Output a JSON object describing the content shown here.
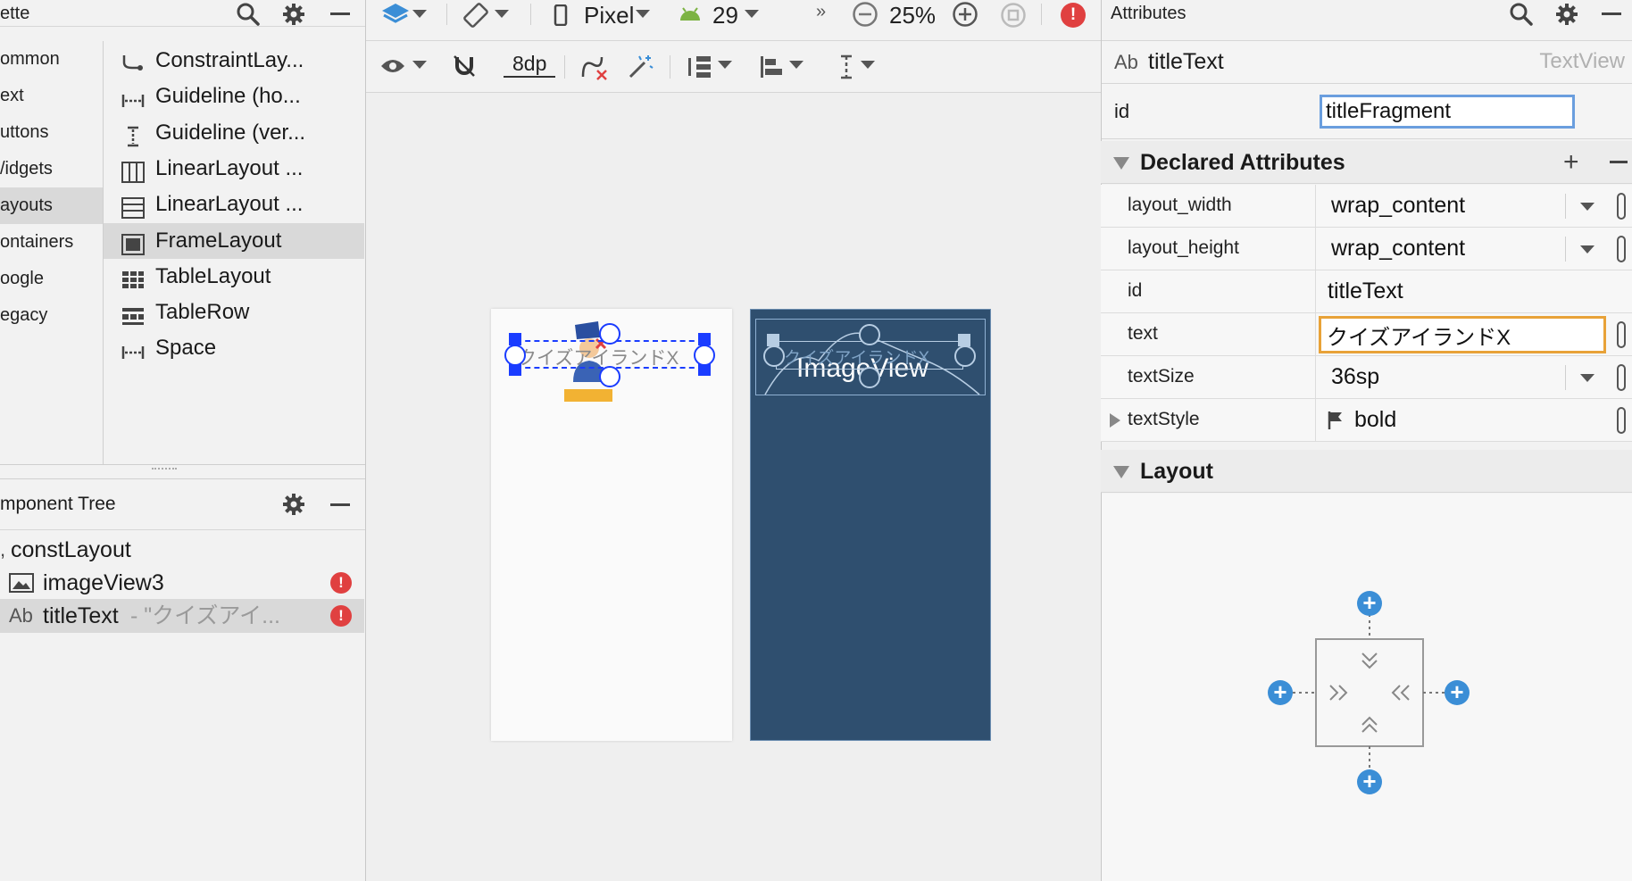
{
  "palette": {
    "title": "ette",
    "categories": [
      "ommon",
      "ext",
      "uttons",
      "/idgets",
      "ayouts",
      "ontainers",
      "oogle",
      "egacy"
    ],
    "selected_category": 4,
    "items": [
      {
        "label": "ConstraintLay...",
        "icon": "constraint-layout-icon"
      },
      {
        "label": "Guideline (ho...",
        "icon": "guideline-horizontal-icon"
      },
      {
        "label": "Guideline (ver...",
        "icon": "guideline-vertical-icon"
      },
      {
        "label": "LinearLayout ...",
        "icon": "linear-layout-vertical-icon"
      },
      {
        "label": "LinearLayout ...",
        "icon": "linear-layout-horizontal-icon"
      },
      {
        "label": "FrameLayout",
        "icon": "frame-layout-icon"
      },
      {
        "label": "TableLayout",
        "icon": "table-layout-icon"
      },
      {
        "label": "TableRow",
        "icon": "table-row-icon"
      },
      {
        "label": "Space",
        "icon": "space-icon"
      }
    ],
    "selected_item": 5
  },
  "tree": {
    "title": "mponent Tree",
    "root": "constLayout",
    "nodes": [
      {
        "label": "imageView3",
        "icon": "image-icon",
        "error": true
      },
      {
        "label": "titleText",
        "prefix": "Ab",
        "suffix": "- \"クイズアイ...",
        "error": true
      }
    ]
  },
  "toolbar": {
    "device": "Pixel",
    "api": "29",
    "zoom": "25%",
    "margin": "8dp",
    "overflow": "»"
  },
  "canvas": {
    "design_title_text": "クイズアイランドX",
    "blueprint_title_text": "クイズアイランドX",
    "blueprint_image_text": "ImageView"
  },
  "attributes": {
    "title": "Attributes",
    "component_prefix": "Ab",
    "component_name": "titleText",
    "component_type": "TextView",
    "id_label": "id",
    "id_value": "titleFragment",
    "declared_title": "Declared Attributes",
    "rows": [
      {
        "label": "layout_width",
        "value": "wrap_content"
      },
      {
        "label": "layout_height",
        "value": "wrap_content"
      },
      {
        "label": "id",
        "value": "titleText"
      },
      {
        "label": "text",
        "value": "クイズアイランドX"
      },
      {
        "label": "textSize",
        "value": "36sp"
      },
      {
        "label": "textStyle",
        "value": "bold"
      }
    ],
    "layout_title": "Layout"
  },
  "colors": {
    "blueprint": "#2f4f6f",
    "selection": "#1a3cff",
    "accent_blue": "#3b8ed6",
    "error": "#e04040",
    "focus_orange": "#e8a238",
    "focus_blue": "#6a9ede"
  }
}
